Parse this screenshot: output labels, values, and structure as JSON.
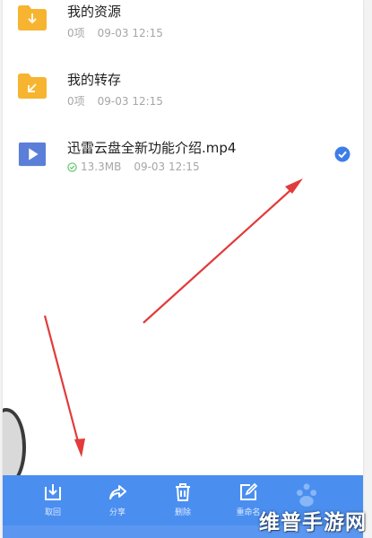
{
  "files": [
    {
      "name": "我的资源",
      "count": "0项",
      "date": "09-03 12:15",
      "icon": "folder-download-icon"
    },
    {
      "name": "我的转存",
      "count": "0项",
      "date": "09-03 12:15",
      "icon": "folder-import-icon"
    },
    {
      "name": "迅雷云盘全新功能介绍.mp4",
      "size": "13.3MB",
      "date": "09-03 12:15",
      "icon": "video-play-icon",
      "synced": true,
      "selected": true
    }
  ],
  "toolbar": {
    "download": "取回",
    "share": "分享",
    "delete": "删除",
    "rename": "重命名"
  },
  "watermark": "维普手游网",
  "colors": {
    "accent": "#4a8ff0",
    "folder": "#f6b431",
    "video": "#5b7fd8",
    "arrow": "#e23b3b",
    "check": "#3d7de8"
  }
}
